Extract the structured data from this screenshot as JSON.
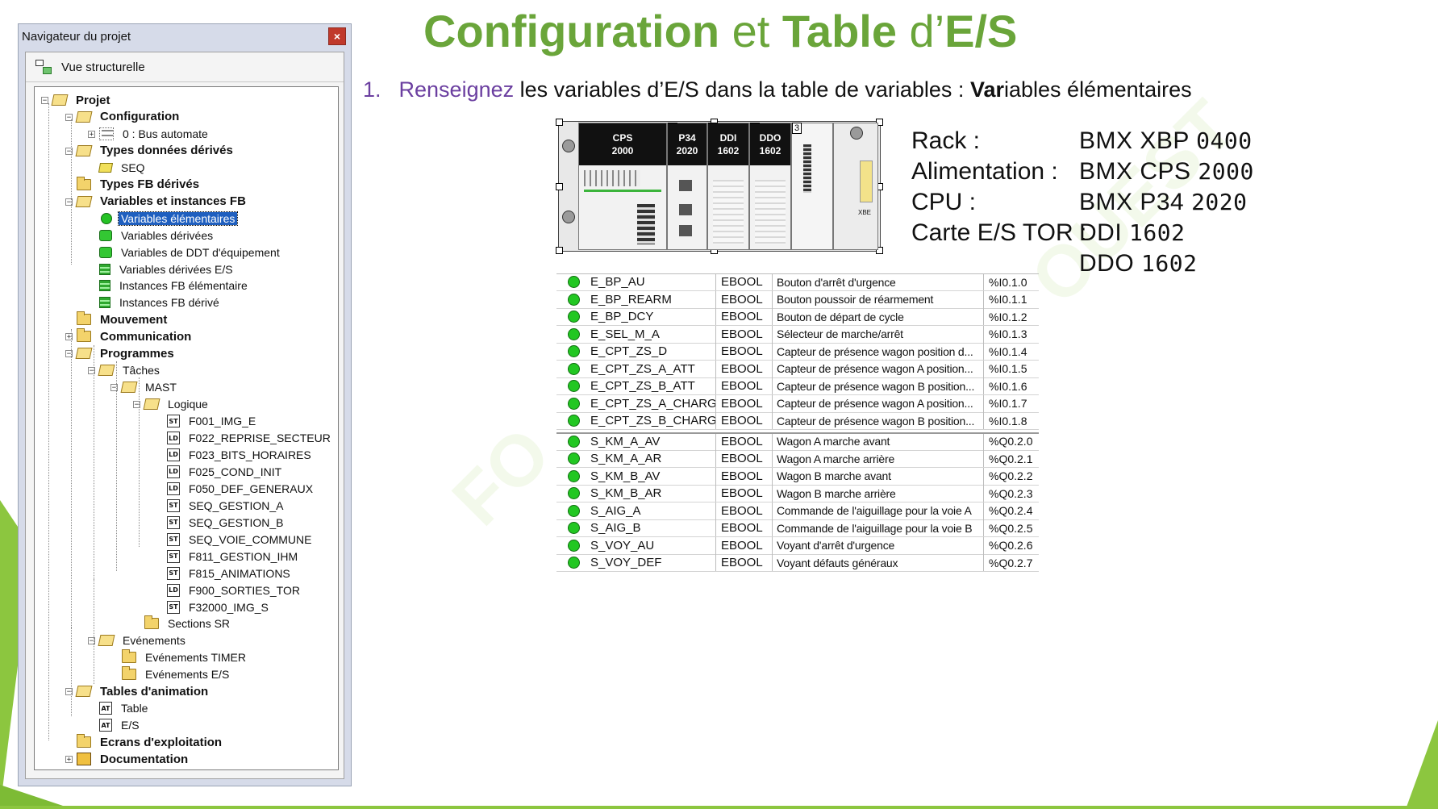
{
  "slide": {
    "title_part1": "Configuration",
    "title_part2": " et ",
    "title_part3": "Table",
    "title_part4": " d’",
    "title_part5": "E/S",
    "step_number": "1.",
    "step_highlight": "Renseignez",
    "step_text": " les variables d’E/S dans la table de variables : ",
    "step_bold": "Var",
    "step_end": "iables élémentaires",
    "accent_color": "#6aa53a",
    "purple_color": "#6b3fa0"
  },
  "navigator": {
    "title": "Navigateur du projet",
    "close_label": "×",
    "view_label": "Vue structurelle",
    "tree": [
      {
        "label": "Projet",
        "bold": true
      },
      {
        "label": "Configuration",
        "bold": true
      },
      {
        "label": "0 : Bus automate",
        "bold": false
      },
      {
        "label": "Types données dérivés",
        "bold": true
      },
      {
        "label": "SEQ",
        "bold": false
      },
      {
        "label": "Types FB dérivés",
        "bold": true
      },
      {
        "label": "Variables et instances FB",
        "bold": true
      },
      {
        "label": "Variables élémentaires",
        "bold": false,
        "selected": true
      },
      {
        "label": "Variables dérivées",
        "bold": false
      },
      {
        "label": "Variables de DDT d'équipement",
        "bold": false
      },
      {
        "label": "Variables dérivées E/S",
        "bold": false
      },
      {
        "label": "Instances FB élémentaire",
        "bold": false
      },
      {
        "label": "Instances FB dérivé",
        "bold": false
      },
      {
        "label": "Mouvement",
        "bold": true
      },
      {
        "label": "Communication",
        "bold": true
      },
      {
        "label": "Programmes",
        "bold": true
      },
      {
        "label": "Tâches",
        "bold": false
      },
      {
        "label": "MAST",
        "bold": false
      },
      {
        "label": "Logique",
        "bold": false
      },
      {
        "label": "F001_IMG_E",
        "bold": false,
        "tag": "ST"
      },
      {
        "label": "F022_REPRISE_SECTEUR",
        "bold": false,
        "tag": "LD"
      },
      {
        "label": "F023_BITS_HORAIRES",
        "bold": false,
        "tag": "LD"
      },
      {
        "label": "F025_COND_INIT",
        "bold": false,
        "tag": "LD"
      },
      {
        "label": "F050_DEF_GENERAUX",
        "bold": false,
        "tag": "LD"
      },
      {
        "label": "SEQ_GESTION_A",
        "bold": false,
        "tag": "ST"
      },
      {
        "label": "SEQ_GESTION_B",
        "bold": false,
        "tag": "ST"
      },
      {
        "label": "SEQ_VOIE_COMMUNE",
        "bold": false,
        "tag": "ST"
      },
      {
        "label": "F811_GESTION_IHM",
        "bold": false,
        "tag": "ST"
      },
      {
        "label": "F815_ANIMATIONS",
        "bold": false,
        "tag": "ST"
      },
      {
        "label": "F900_SORTIES_TOR",
        "bold": false,
        "tag": "LD"
      },
      {
        "label": "F32000_IMG_S",
        "bold": false,
        "tag": "ST"
      },
      {
        "label": "Sections SR",
        "bold": false
      },
      {
        "label": "Evénements",
        "bold": false
      },
      {
        "label": "Evénements TIMER",
        "bold": false
      },
      {
        "label": "Evénements E/S",
        "bold": false
      },
      {
        "label": "Tables d'animation",
        "bold": true
      },
      {
        "label": "Table",
        "bold": false,
        "tag": "AT"
      },
      {
        "label": "E/S",
        "bold": false,
        "tag": "AT"
      },
      {
        "label": "Ecrans d'exploitation",
        "bold": true
      },
      {
        "label": "Documentation",
        "bold": true
      }
    ]
  },
  "rack": {
    "modules": [
      {
        "slot": "",
        "line1": "CPS",
        "line2": "2000"
      },
      {
        "slot": "0",
        "line1": "P34",
        "line2": "2020"
      },
      {
        "slot": "1",
        "line1": "DDI",
        "line2": "1602"
      },
      {
        "slot": "2",
        "line1": "DDO",
        "line2": "1602"
      },
      {
        "slot": "3",
        "line1": "",
        "line2": ""
      }
    ],
    "xbe_label": "XBE"
  },
  "specs": [
    {
      "key": "Rack :",
      "val_a": "BMX XBP ",
      "val_b": "0400"
    },
    {
      "key": "Alimentation :",
      "val_a": "BMX CPS ",
      "val_b": "2000"
    },
    {
      "key": "CPU :",
      "val_a": "BMX P34 ",
      "val_b": "2020"
    },
    {
      "key": "Carte E/S TOR :",
      "val_a": "DDI ",
      "val_b": "1602"
    },
    {
      "key": "",
      "val_a": "DDO ",
      "val_b": "1602"
    }
  ],
  "variables": [
    {
      "name": "E_BP_AU",
      "type": "EBOOL",
      "comment": "Bouton d'arrêt d'urgence",
      "addr": "%I0.1.0"
    },
    {
      "name": "E_BP_REARM",
      "type": "EBOOL",
      "comment": "Bouton poussoir de réarmement",
      "addr": "%I0.1.1"
    },
    {
      "name": "E_BP_DCY",
      "type": "EBOOL",
      "comment": "Bouton de départ de cycle",
      "addr": "%I0.1.2"
    },
    {
      "name": "E_SEL_M_A",
      "type": "EBOOL",
      "comment": "Sélecteur de marche/arrêt",
      "addr": "%I0.1.3"
    },
    {
      "name": "E_CPT_ZS_D",
      "type": "EBOOL",
      "comment": "Capteur de présence wagon position d...",
      "addr": "%I0.1.4"
    },
    {
      "name": "E_CPT_ZS_A_ATT",
      "type": "EBOOL",
      "comment": "Capteur de présence wagon A position...",
      "addr": "%I0.1.5"
    },
    {
      "name": "E_CPT_ZS_B_ATT",
      "type": "EBOOL",
      "comment": "Capteur de présence wagon B position...",
      "addr": "%I0.1.6"
    },
    {
      "name": "E_CPT_ZS_A_CHARG",
      "type": "EBOOL",
      "comment": "Capteur de présence wagon A position...",
      "addr": "%I0.1.7"
    },
    {
      "name": "E_CPT_ZS_B_CHARG",
      "type": "EBOOL",
      "comment": "Capteur de présence wagon B position...",
      "addr": "%I0.1.8"
    },
    {
      "name": "S_KM_A_AV",
      "type": "EBOOL",
      "comment": "Wagon A marche avant",
      "addr": "%Q0.2.0"
    },
    {
      "name": "S_KM_A_AR",
      "type": "EBOOL",
      "comment": "Wagon A marche arrière",
      "addr": "%Q0.2.1"
    },
    {
      "name": "S_KM_B_AV",
      "type": "EBOOL",
      "comment": "Wagon B marche avant",
      "addr": "%Q0.2.2"
    },
    {
      "name": "S_KM_B_AR",
      "type": "EBOOL",
      "comment": "Wagon B marche arrière",
      "addr": "%Q0.2.3"
    },
    {
      "name": "S_AIG_A",
      "type": "EBOOL",
      "comment": "Commande de l'aiguillage pour la voie A",
      "addr": "%Q0.2.4"
    },
    {
      "name": "S_AIG_B",
      "type": "EBOOL",
      "comment": "Commande de l'aiguillage pour la voie B",
      "addr": "%Q0.2.5"
    },
    {
      "name": "S_VOY_AU",
      "type": "EBOOL",
      "comment": "Voyant d'arrêt d'urgence",
      "addr": "%Q0.2.6"
    },
    {
      "name": "S_VOY_DEF",
      "type": "EBOOL",
      "comment": "Voyant défauts généraux",
      "addr": "%Q0.2.7"
    }
  ]
}
